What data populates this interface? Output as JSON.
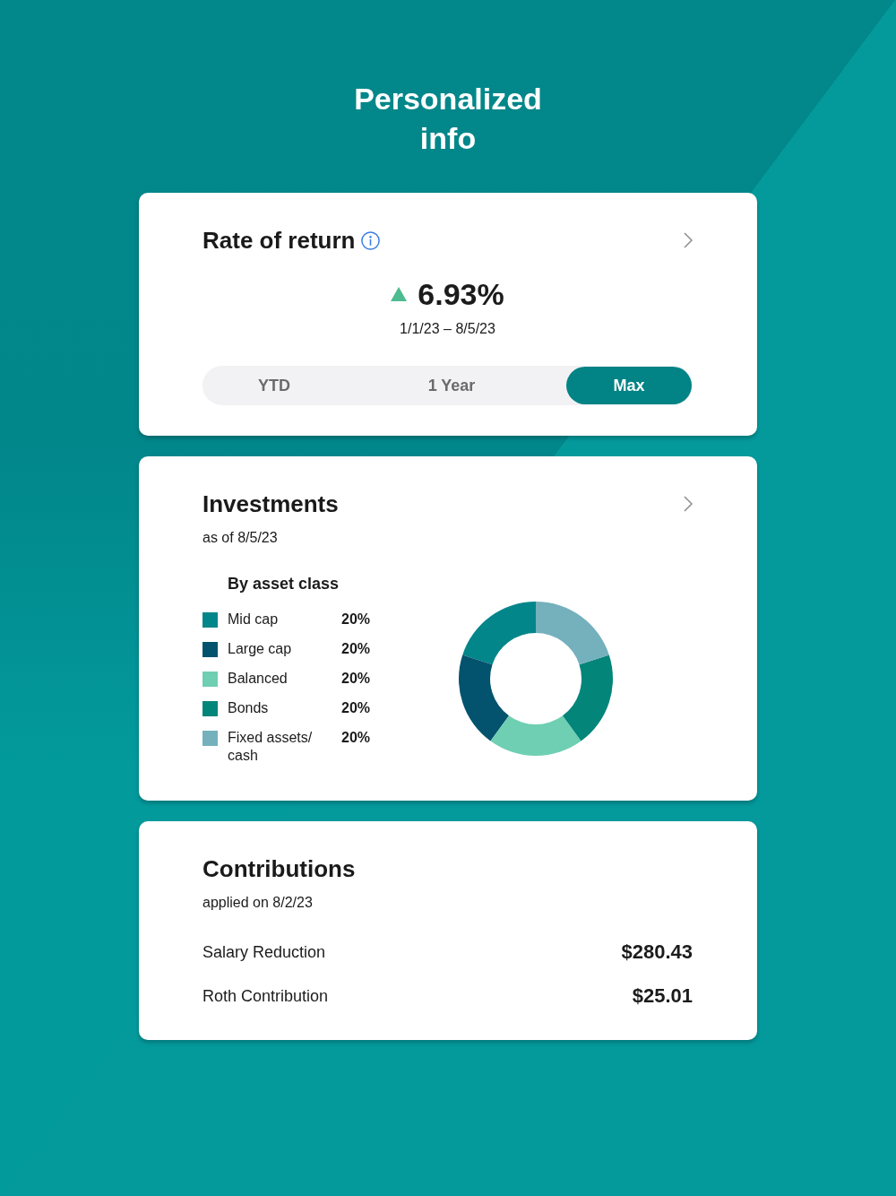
{
  "header": {
    "title": "Personalized info"
  },
  "rate_of_return": {
    "title": "Rate of return",
    "trend_up": true,
    "value": "6.93%",
    "period": "1/1/23 – 8/5/23",
    "periods": [
      {
        "label": "YTD",
        "selected": false
      },
      {
        "label": "1 Year",
        "selected": false
      },
      {
        "label": "Max",
        "selected": true
      }
    ]
  },
  "investments": {
    "title": "Investments",
    "subtitle": "as of 8/5/23",
    "breakdown_title": "By asset class",
    "legend": [
      {
        "label": "Mid cap",
        "percent": "20%",
        "color": "#02868a"
      },
      {
        "label": "Large cap",
        "percent": "20%",
        "color": "#03536e"
      },
      {
        "label": "Balanced",
        "percent": "20%",
        "color": "#6fcfb2"
      },
      {
        "label": "Bonds",
        "percent": "20%",
        "color": "#03857a"
      },
      {
        "label": "Fixed assets/ cash",
        "percent": "20%",
        "color": "#75b0bd"
      }
    ],
    "chart_data": {
      "type": "donut",
      "values": [
        20,
        20,
        20,
        20,
        20
      ]
    }
  },
  "contributions": {
    "title": "Contributions",
    "subtitle": "applied on 8/2/23",
    "rows": [
      {
        "label": "Salary Reduction",
        "amount": "$280.43"
      },
      {
        "label": "Roth Contribution",
        "amount": "$25.01"
      }
    ]
  }
}
